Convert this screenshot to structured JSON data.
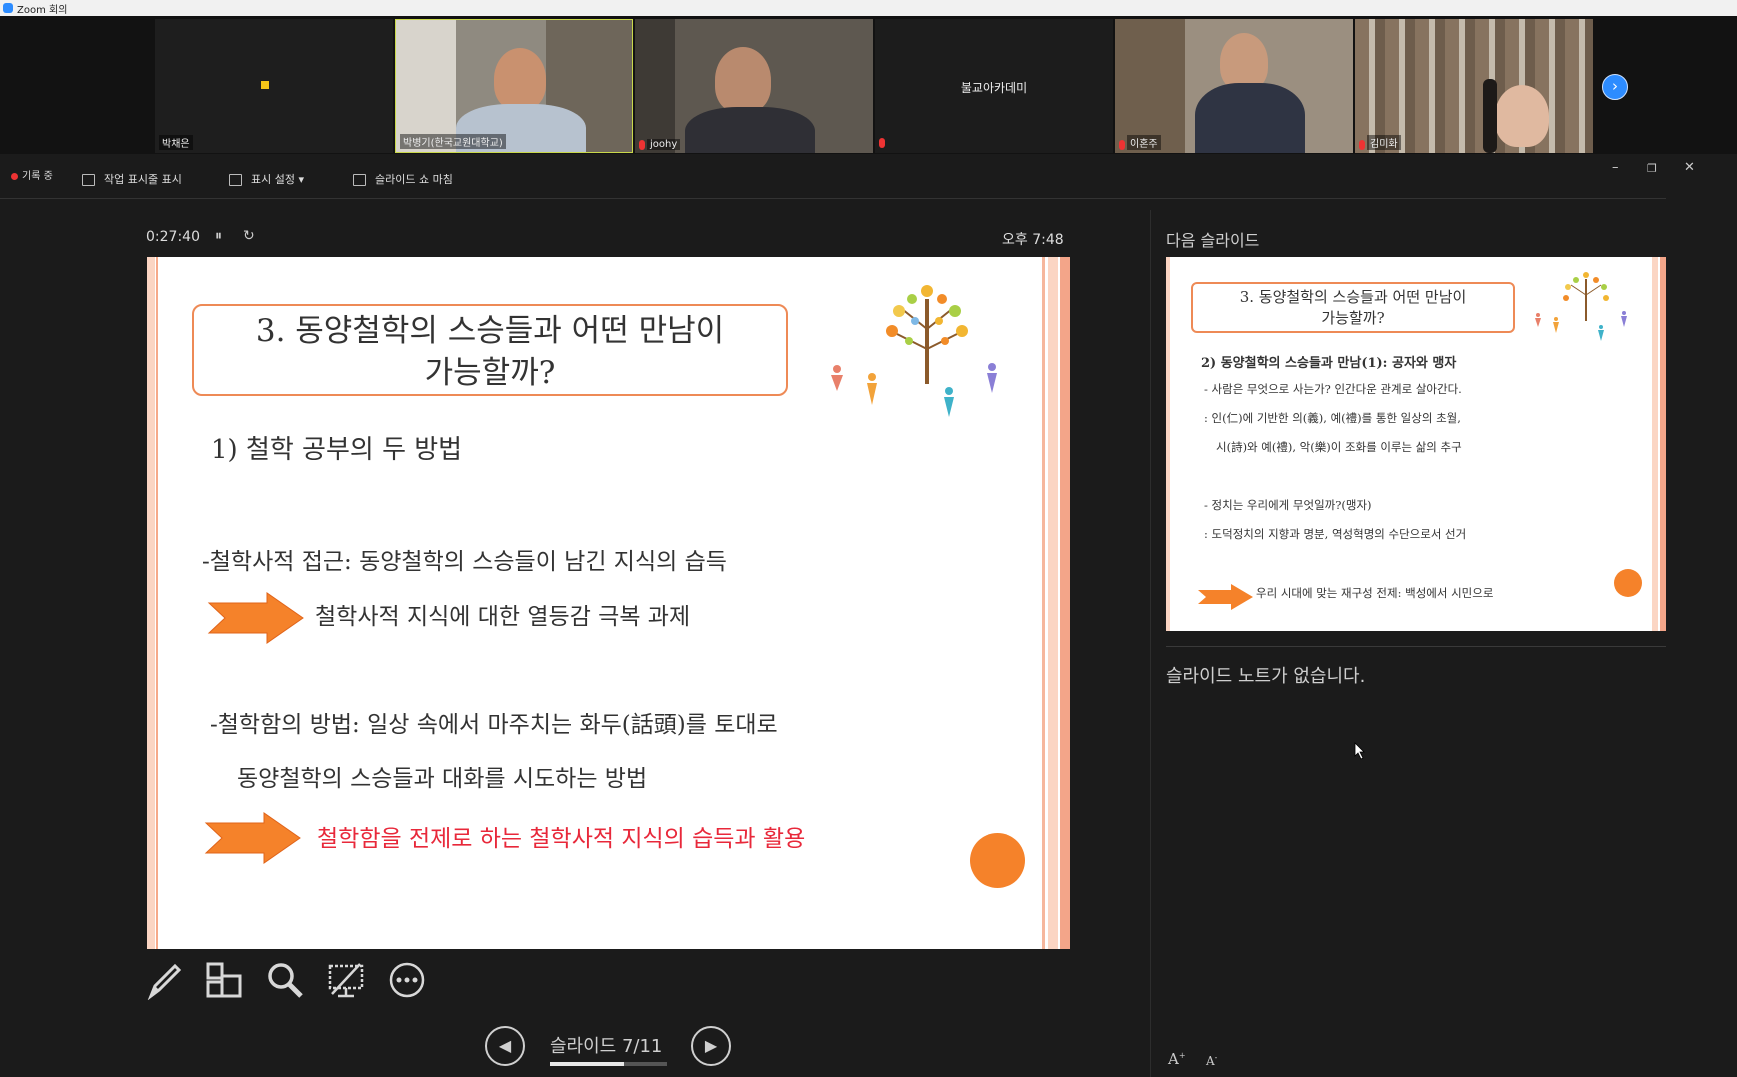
{
  "window": {
    "title": "Zoom 회의"
  },
  "gallery": {
    "participants": [
      {
        "name": "박채은"
      },
      {
        "name": "박병기(한국교원대학교)"
      },
      {
        "name": "joohy"
      },
      {
        "name": "불교아카데미"
      },
      {
        "name": "이혼주"
      },
      {
        "name": "김미화"
      }
    ]
  },
  "toolbar": {
    "recording_label": "기록 중",
    "show_taskbar_label": "작업 표시줄 표시",
    "display_settings_label": "표시 설정 ▾",
    "end_slideshow_label": "슬라이드 쇼 마침"
  },
  "presenter": {
    "elapsed": "0:27:40",
    "clock": "오후 7:48",
    "slide_counter": "슬라이드 7/11",
    "progress": 0.636,
    "next_slide_label": "다음 슬라이드",
    "notes_text": "슬라이드 노트가 없습니다."
  },
  "current_slide": {
    "title_line1": "3. 동양철학의 스승들과 어떤 만남이",
    "title_line2": "가능할까?",
    "heading": "1) 철학 공부의 두 방법",
    "point1": "-철학사적 접근: 동양철학의 스승들이 남긴 지식의 습득",
    "point1_arrow_text": "철학사적 지식에 대한 열등감 극복 과제",
    "point2_line1": "-철학함의 방법: 일상 속에서 마주치는 화두(話頭)를 토대로",
    "point2_line2": "동양철학의 스승들과 대화를 시도하는 방법",
    "point2_arrow_text": "철학함을 전제로 하는 철학사적 지식의 습득과 활용",
    "accent_color": "#f5822a",
    "highlight_color": "#e8283a"
  },
  "next_slide": {
    "title_line1": "3. 동양철학의 스승들과 어떤 만남이",
    "title_line2": "가능할까?",
    "heading": "2) 동양철학의 스승들과 만남(1): 공자와 맹자",
    "line1": "- 사람은 무엇으로 사는가? 인간다운 관계로 살아간다.",
    "line2": ": 인(仁)에 기반한 의(義), 예(禮)를 통한 일상의 초월,",
    "line3": "시(詩)와 예(禮), 악(樂)이 조화를 이루는 삶의 추구",
    "line4": "- 정치는 우리에게 무엇일까?(맹자)",
    "line5": ": 도덕정치의 지향과 명분, 역성혁명의 수단으로서 선거",
    "arrow_text": "우리 시대에 맞는 재구성 전제: 백성에서 시민으로"
  },
  "icons": {
    "pen": "pen-icon",
    "grid": "slides-grid-icon",
    "search": "magnifier-icon",
    "screen": "screen-off-icon",
    "more": "more-icon",
    "prev": "prev-icon",
    "next": "next-icon",
    "font_up": "A",
    "font_down": "A"
  }
}
